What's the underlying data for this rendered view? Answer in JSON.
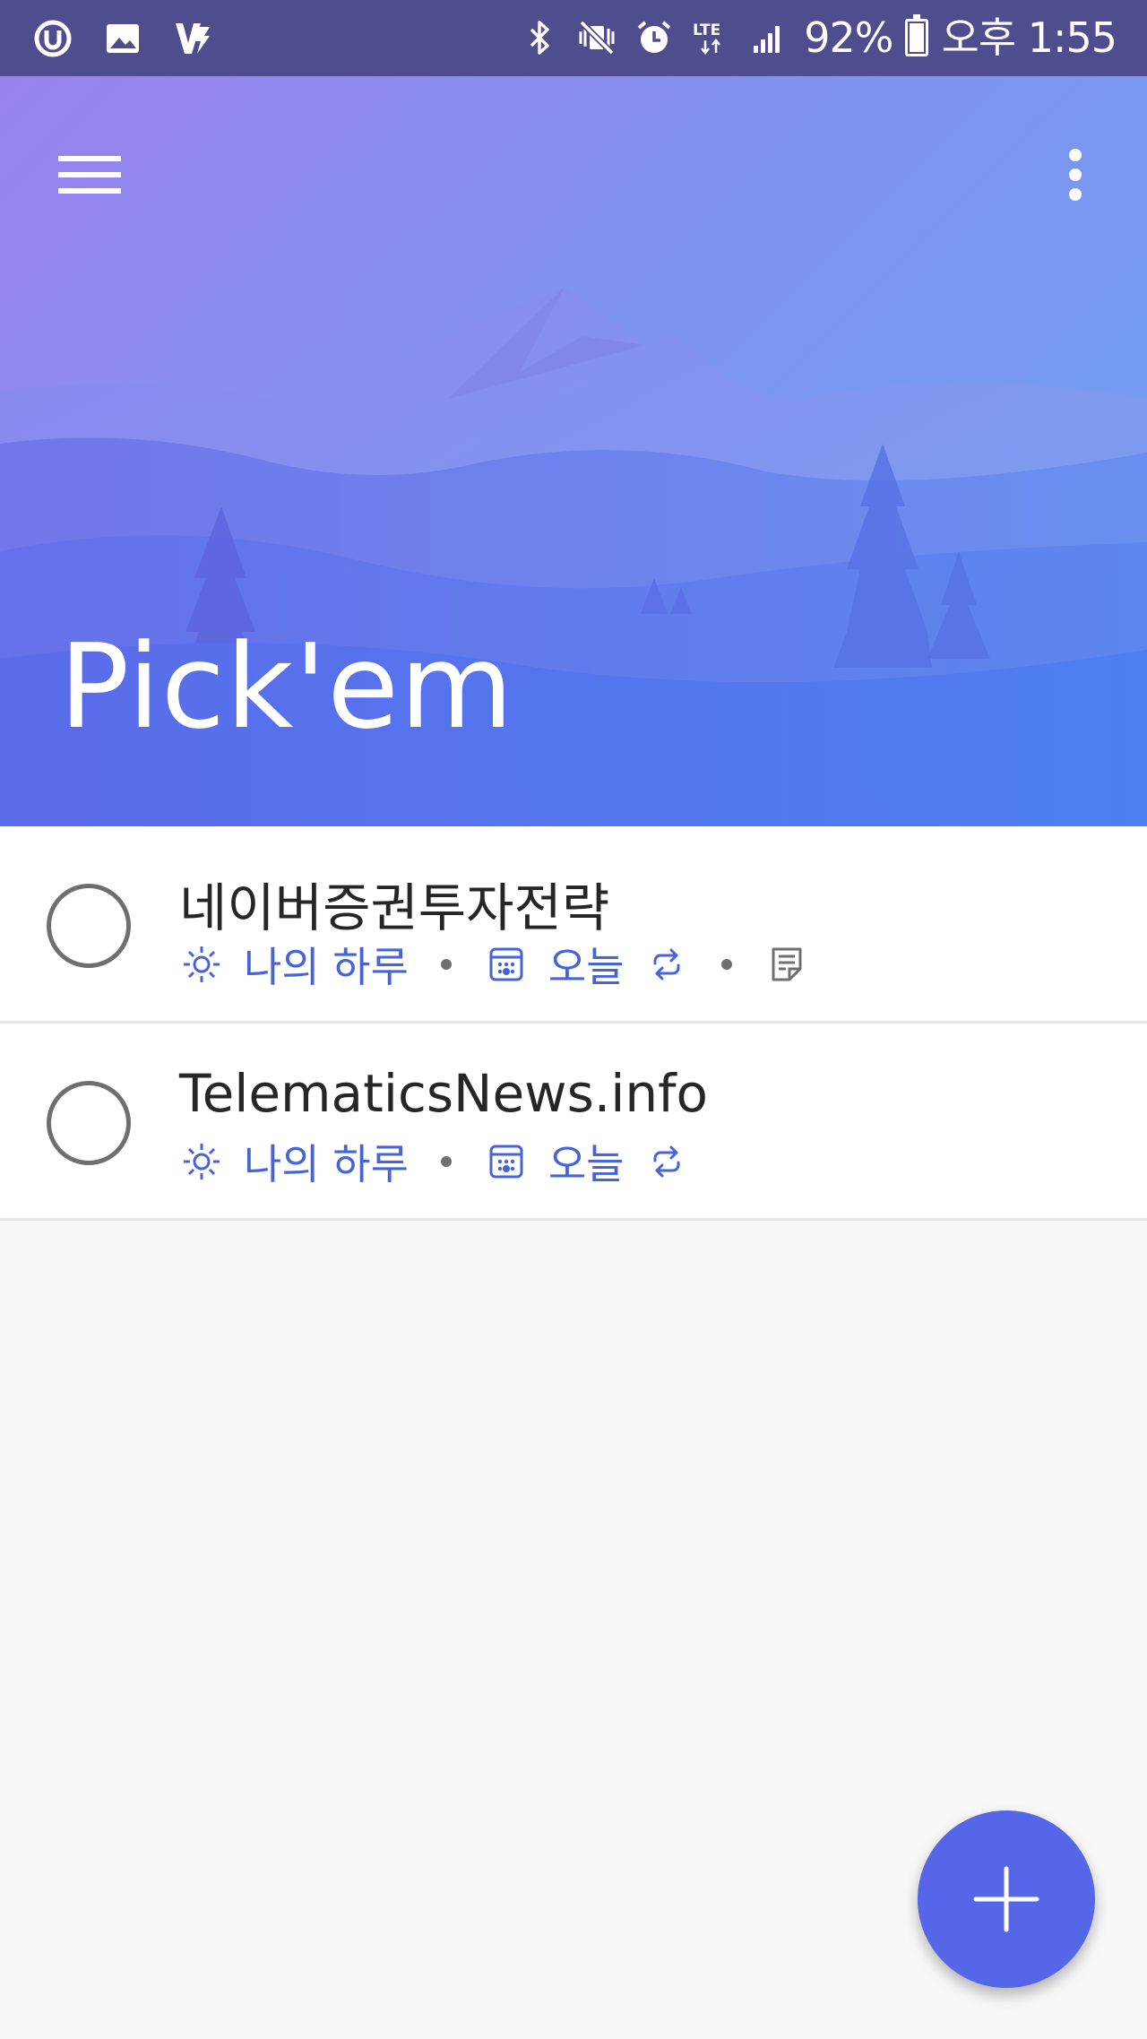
{
  "status_bar": {
    "battery_percent": "92%",
    "network": "LTE",
    "time": "오후 1:55",
    "icons_left": [
      "u-plus-icon",
      "gallery-icon",
      "v3-icon"
    ],
    "icons_right": [
      "bluetooth-icon",
      "vibrate-icon",
      "alarm-icon",
      "lte-icon",
      "signal-icon",
      "battery-icon"
    ]
  },
  "header": {
    "title": "Pick'em",
    "menu_icon": "hamburger-menu-icon",
    "more_icon": "more-vert-icon",
    "gradient_colors": [
      "#9a82ee",
      "#6ea3f4"
    ]
  },
  "tasks": [
    {
      "title": "네이버증권투자전략",
      "my_day_label": "나의 하루",
      "due_label": "오늘",
      "repeat": true,
      "has_note": true
    },
    {
      "title": "TelematicsNews.info",
      "my_day_label": "나의 하루",
      "due_label": "오늘",
      "repeat": true,
      "has_note": false
    }
  ],
  "colors": {
    "accent": "#4764d6",
    "fab": "#5566e8",
    "status_bar": "#4f4d8e"
  },
  "fab": {
    "icon": "plus-icon"
  }
}
